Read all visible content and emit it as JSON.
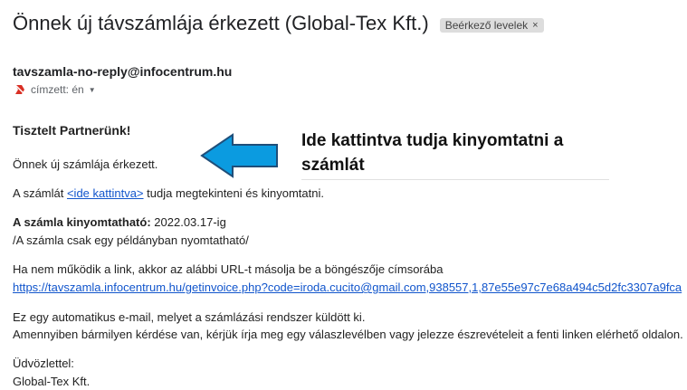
{
  "email": {
    "subject": "Önnek új távszámlája érkezett (Global-Tex Kft.)",
    "label": "Beérkező levelek",
    "label_remove": "×",
    "sender": "tavszamla-no-reply@infocentrum.hu",
    "recipient": "címzett: én",
    "recipient_caret": "▼"
  },
  "body": {
    "greeting": "Tisztelt Partnerünk!",
    "line1": "Önnek új számlája érkezett.",
    "line2_prefix": "A számlát ",
    "line2_link": "<ide kattintva>",
    "line2_suffix": " tudja megtekinteni és kinyomtatni.",
    "print_label": "A számla kinyomtatható:",
    "print_date": " 2022.03.17-ig",
    "print_note": "/A számla csak egy példányban nyomtatható/",
    "fallback_text": "Ha nem működik a link, akkor az alábbi URL-t másolja be a böngészője címsorába",
    "fallback_url": "https://tavszamla.infocentrum.hu/getinvoice.php?code=iroda.cucito@gmail.com,938557,1,87e55e97c7e68a494c5d2fc3307a9fca",
    "auto_line1": "Ez egy automatikus e-mail, melyet a számlázási rendszer küldött ki.",
    "auto_line2": "Amennyiben bármilyen kérdése van, kérjük írja meg egy válaszlevélben vagy jelezze észrevételeit a fenti linken elérhető oldalon.",
    "closing": "Üdvözlettel:",
    "signature": "Global-Tex Kft."
  },
  "annotation": {
    "line1": "Ide kattintva tudja kinyomtatni a",
    "line2": "számlát",
    "arrow_color": "#0b9be0"
  }
}
